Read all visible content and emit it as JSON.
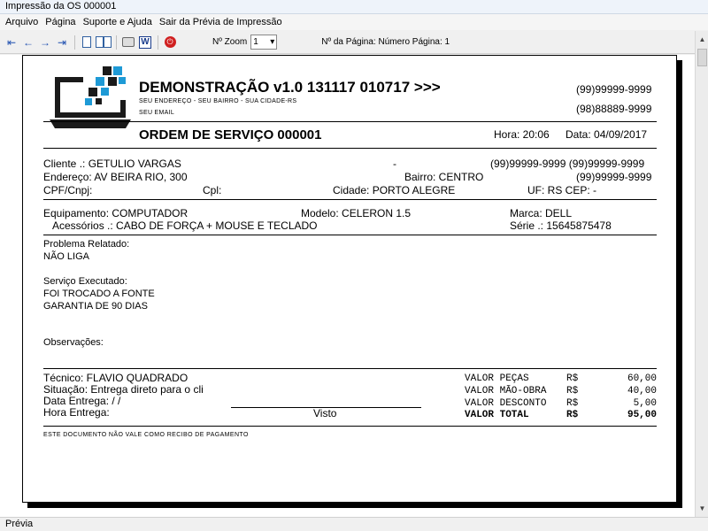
{
  "window": {
    "title": "Impressão da OS 000001"
  },
  "menu": [
    "Arquivo",
    "Página",
    "Suporte e Ajuda",
    "Sair da Prévia de Impressão"
  ],
  "toolbar": {
    "zoom_label": "Nº Zoom",
    "zoom_value": "1",
    "page_label": "Nº da Página: Número Página: 1",
    "word_glyph": "W",
    "close_glyph": "⏻"
  },
  "report": {
    "company": "DEMONSTRAÇÃO v1.0 131117 010717 >>>",
    "address": "SEU ENDEREÇO - SEU BAIRRO - SUA CIDADE-RS",
    "email": "SEU EMAIL",
    "phone1": "(99)99999-9999",
    "phone2": "(98)88889-9999",
    "os_title": "ORDEM DE SERVIÇO  000001",
    "hora": "Hora: 20:06",
    "data": "Data: 04/09/2017",
    "client": {
      "cliente": "Cliente   .: GETULIO VARGAS",
      "dash": "-",
      "phones": "(99)99999-9999  (99)99999-9999",
      "endereco": "Endereço: AV BEIRA RIO, 300",
      "bairro": "Bairro: CENTRO",
      "phone3": "(99)99999-9999",
      "cpf": "CPF/Cnpj:",
      "cpl": "Cpl:",
      "cidade": "Cidade: PORTO ALEGRE",
      "uf": "UF: RS  CEP:     -"
    },
    "equipment": {
      "equipamento": "Equipamento: COMPUTADOR",
      "modelo": "Modelo: CELERON 1.5",
      "marca": "Marca: DELL",
      "acessorios": "Acessórios .: CABO DE FORÇA + MOUSE E TECLADO",
      "serie": "Série .: 15645875478"
    },
    "problema_label": "Problema Relatado:",
    "problema": "NÃO LIGA",
    "servico_label": "Serviço Executado:",
    "servico_lines": [
      "FOI TROCADO A FONTE",
      "GARANTIA DE 90 DIAS"
    ],
    "observacoes_label": "Observações:",
    "tecnico": "Técnico: FLAVIO QUADRADO",
    "situacao": "Situação: Entrega direto para o cli",
    "data_entrega": "Data Entrega:  /  /",
    "hora_entrega": "Hora Entrega:",
    "visto": "Visto",
    "valores": [
      {
        "label": "VALOR PEÇAS",
        "currency": "R$",
        "value": "60,00"
      },
      {
        "label": "VALOR MÃO-OBRA",
        "currency": "R$",
        "value": "40,00"
      },
      {
        "label": "VALOR DESCONTO",
        "currency": "R$",
        "value": "5,00"
      },
      {
        "label": "VALOR  TOTAL",
        "currency": "R$",
        "value": "95,00"
      }
    ],
    "footer": "ESTE DOCUMENTO NÃO VALE COMO RECIBO DE PAGAMENTO"
  },
  "status": "Prévia",
  "colors": {
    "logo_blue": "#1e9ad6",
    "logo_dark": "#1a1a1a"
  }
}
